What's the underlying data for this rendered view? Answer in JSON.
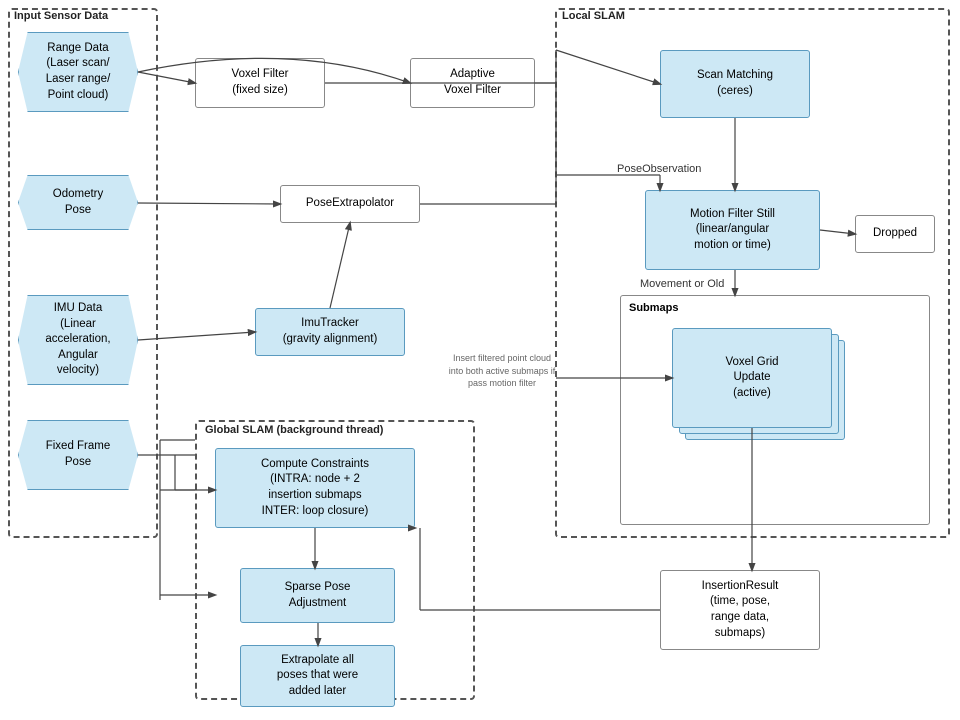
{
  "sections": {
    "input": "Input Sensor Data",
    "local_slam": "Local SLAM",
    "global_slam": "Global SLAM (background thread)"
  },
  "boxes": {
    "range_data": "Range Data\n(Laser scan/\nLaser range/\nPoint cloud)",
    "odometry_pose": "Odometry\nPose",
    "imu_data": "IMU Data\n(Linear\nacceleration,\nAngular\nvelocity)",
    "fixed_frame_pose": "Fixed Frame\nPose",
    "voxel_filter": "Voxel Filter\n(fixed size)",
    "adaptive_voxel_filter": "Adaptive\nVoxel Filter",
    "pose_extrapolator": "PoseExtrapolator",
    "imu_tracker": "ImuTracker\n(gravity alignment)",
    "scan_matching": "Scan Matching\n(ceres)",
    "motion_filter": "Motion Filter Still\n(linear/angular\nmotion or time)",
    "dropped": "Dropped",
    "voxel_grid_update": "Voxel Grid\nUpdate\n(active)",
    "compute_constraints": "Compute Constraints\n(INTRA: node + 2\ninsertion submaps\nINTER: loop closure)",
    "sparse_pose": "Sparse Pose\nAdjustment",
    "extrapolate_poses": "Extrapolate all\nposes that were\nadded later",
    "insertion_result": "InsertionResult\n(time, pose,\nrange data,\nsubmaps)",
    "pose_observation_label": "PoseObservation",
    "movement_old_label": "Movement or Old",
    "insert_filtered_label": "Insert filtered point cloud\ninto both active submaps if\npass motion filter"
  }
}
